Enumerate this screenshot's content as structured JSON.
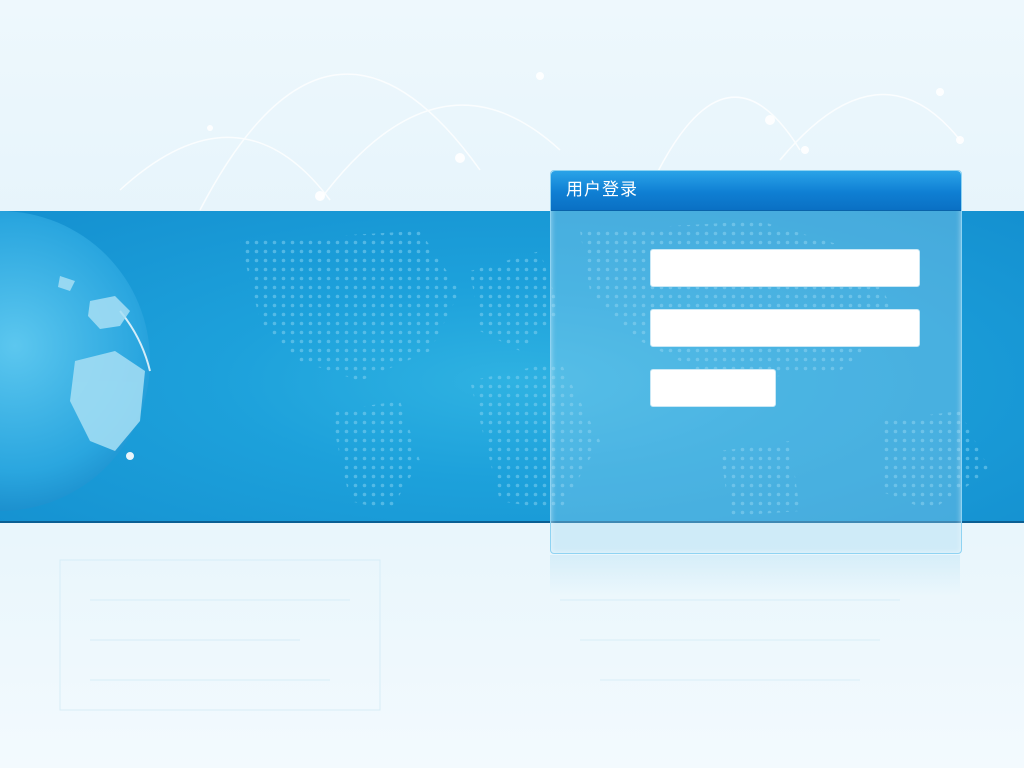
{
  "login": {
    "title": "用户登录",
    "username": {
      "value": "",
      "placeholder": ""
    },
    "password": {
      "value": "",
      "placeholder": ""
    },
    "captcha": {
      "value": "",
      "placeholder": ""
    }
  },
  "colors": {
    "band": "#1da1db",
    "header": "#0f7fd3",
    "page_background": "#eef8fd"
  },
  "icons": [
    "globe-graphic",
    "world-map-dots"
  ]
}
